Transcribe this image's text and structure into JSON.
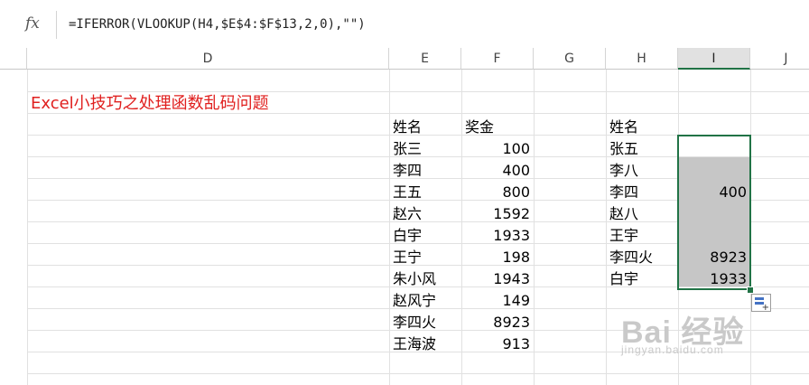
{
  "formula_bar": {
    "fx_label": "fx",
    "formula": "=IFERROR(VLOOKUP(H4,$E$4:$F$13,2,0),\"\")"
  },
  "columns": [
    "D",
    "E",
    "F",
    "G",
    "H",
    "I",
    "J"
  ],
  "selected_column": "I",
  "title": "Excel小技巧之处理函数乱码问题",
  "source_table": {
    "header": [
      "姓名",
      "奖金"
    ],
    "rows": [
      [
        "张三",
        "100"
      ],
      [
        "李四",
        "400"
      ],
      [
        "王五",
        "800"
      ],
      [
        "赵六",
        "1592"
      ],
      [
        "白宇",
        "1933"
      ],
      [
        "王宁",
        "198"
      ],
      [
        "朱小风",
        "1943"
      ],
      [
        "赵风宁",
        "149"
      ],
      [
        "李四火",
        "8923"
      ],
      [
        "王海波",
        "913"
      ]
    ]
  },
  "lookup_table": {
    "header": "姓名",
    "rows": [
      [
        "张五",
        ""
      ],
      [
        "李八",
        ""
      ],
      [
        "李四",
        "400"
      ],
      [
        "赵八",
        ""
      ],
      [
        "王宇",
        ""
      ],
      [
        "李四火",
        "8923"
      ],
      [
        "白宇",
        "1933"
      ]
    ]
  },
  "watermark": {
    "brand": "Bai 经验",
    "site": "jingyan.baidu.com"
  },
  "colors": {
    "selection": "#217346",
    "title_red": "#e0201f",
    "shade": "#c6c6c6"
  }
}
